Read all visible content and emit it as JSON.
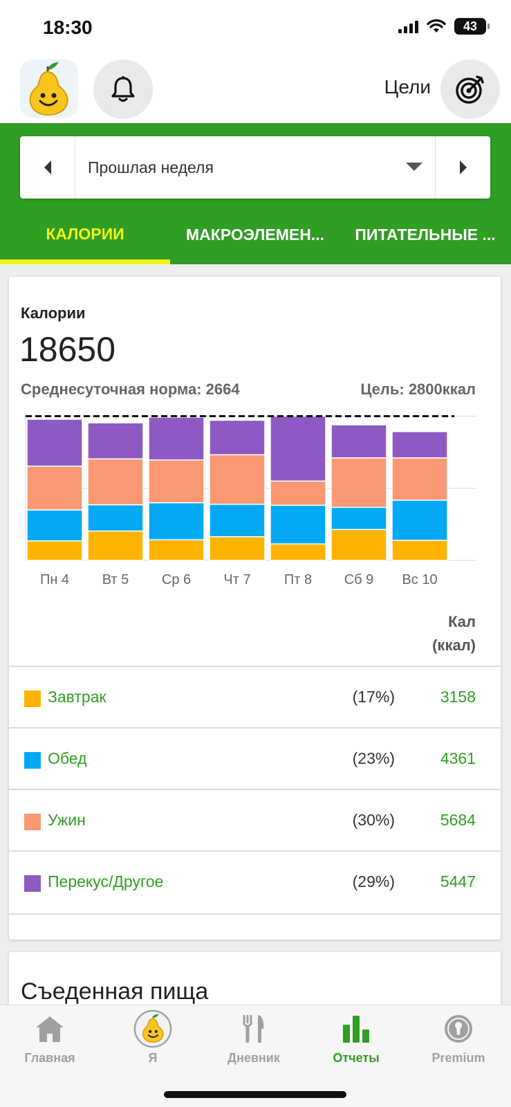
{
  "status": {
    "time": "18:30",
    "battery": "43"
  },
  "header": {
    "goals_label": "Цели"
  },
  "period": {
    "label": "Прошлая неделя"
  },
  "tabs": [
    {
      "label": "КАЛОРИИ",
      "active": true
    },
    {
      "label": "МАКРОЭЛЕМЕН...",
      "active": false
    },
    {
      "label": "ПИТАТЕЛЬНЫЕ ...",
      "active": false
    }
  ],
  "summary": {
    "title": "Калории",
    "total": "18650",
    "avg": "Среднесуточная норма: 2664",
    "goal": "Цель: 2800ккал"
  },
  "colors": {
    "breakfast": "#ffb300",
    "lunch": "#03a9f4",
    "dinner": "#fa9873",
    "snacks": "#8e59c2",
    "accent": "#2f9e23",
    "active_tab": "#f1f41b"
  },
  "chart_data": {
    "type": "bar",
    "stacked": true,
    "categories": [
      "Пн 4",
      "Вт 5",
      "Ср 6",
      "Чт 7",
      "Пт 8",
      "Сб 9",
      "Вс 10"
    ],
    "series": [
      {
        "name": "Завтрак",
        "color": "#ffb300",
        "values": [
          380,
          570,
          400,
          460,
          320,
          600,
          390
        ]
      },
      {
        "name": "Обед",
        "color": "#03a9f4",
        "values": [
          600,
          510,
          720,
          630,
          750,
          430,
          780
        ]
      },
      {
        "name": "Ужин",
        "color": "#fa9873",
        "values": [
          850,
          890,
          830,
          960,
          470,
          960,
          820
        ]
      },
      {
        "name": "Перекус/Другое",
        "color": "#8e59c2",
        "values": [
          910,
          700,
          830,
          670,
          1260,
          640,
          510
        ]
      }
    ],
    "ylim": [
      0,
      2900
    ],
    "goal_line": 2800,
    "grid": true
  },
  "table": {
    "col_head_line1": "Кал",
    "col_head_line2": "(ккал)",
    "rows": [
      {
        "name": "Завтрак",
        "pct": "(17%)",
        "value": "3158",
        "color": "#ffb300"
      },
      {
        "name": "Обед",
        "pct": "(23%)",
        "value": "4361",
        "color": "#03a9f4"
      },
      {
        "name": "Ужин",
        "pct": "(30%)",
        "value": "5684",
        "color": "#fa9873"
      },
      {
        "name": "Перекус/Другое",
        "pct": "(29%)",
        "value": "5447",
        "color": "#8e59c2"
      }
    ]
  },
  "food_section": {
    "title": "Съеденная пища"
  },
  "nav": [
    {
      "label": "Главная",
      "icon": "home-icon"
    },
    {
      "label": "Я",
      "icon": "profile-avatar-icon"
    },
    {
      "label": "Дневник",
      "icon": "fork-knife-icon"
    },
    {
      "label": "Отчеты",
      "icon": "bar-chart-icon",
      "active": true
    },
    {
      "label": "Premium",
      "icon": "premium-badge-icon"
    }
  ]
}
